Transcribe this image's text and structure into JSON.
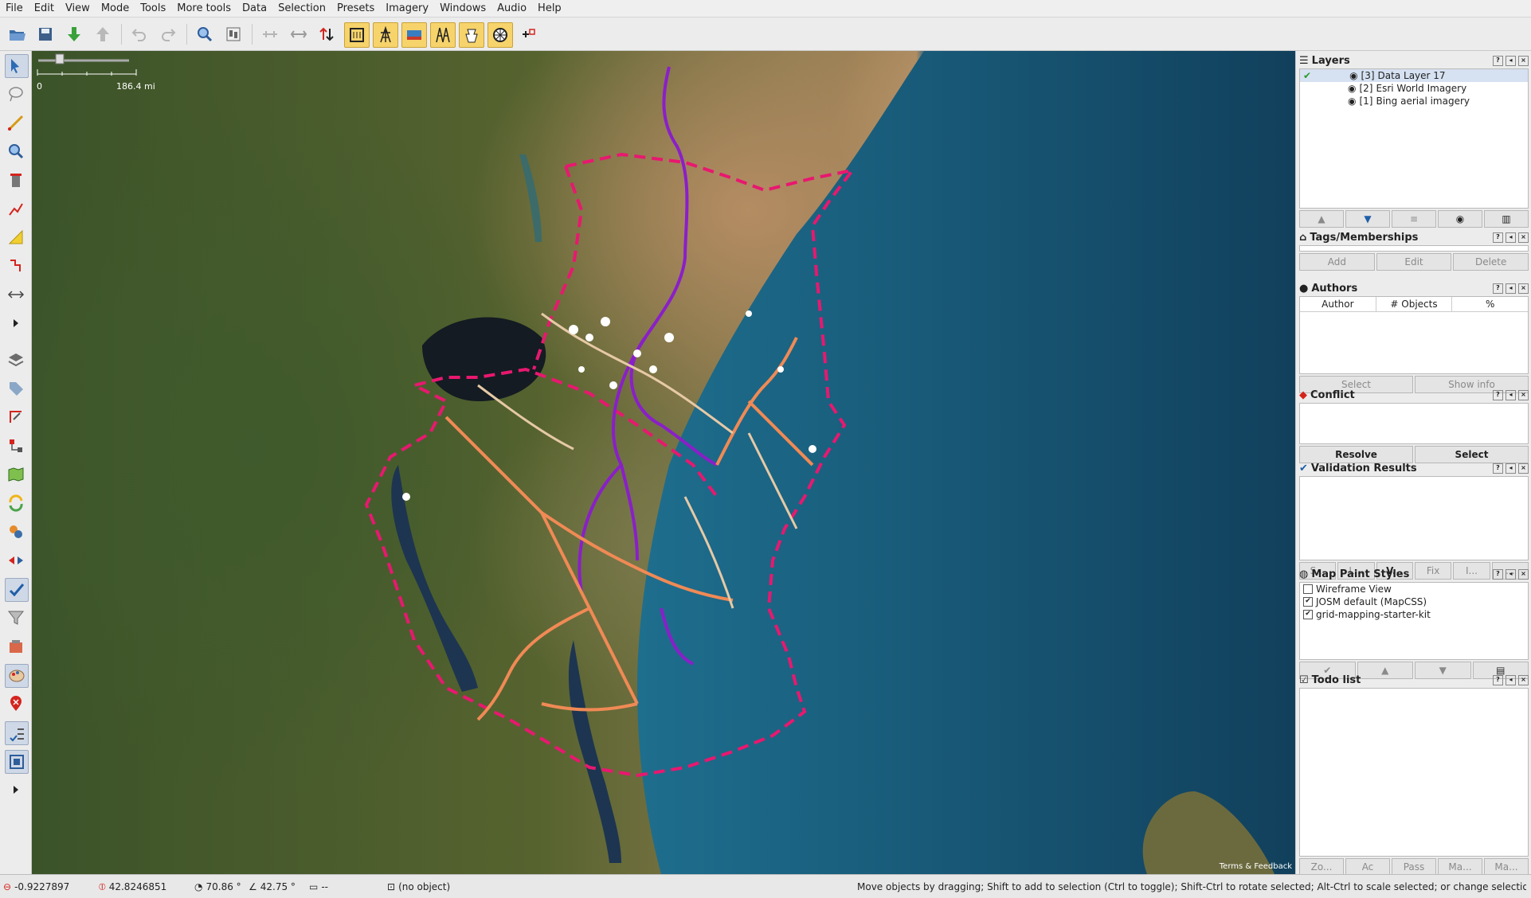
{
  "menu": [
    "File",
    "Edit",
    "View",
    "Mode",
    "Tools",
    "More tools",
    "Data",
    "Selection",
    "Presets",
    "Imagery",
    "Windows",
    "Audio",
    "Help"
  ],
  "toolbar": {
    "icons": [
      "open-icon",
      "save-icon",
      "download-icon",
      "upload-icon",
      "undo-icon",
      "redo-icon",
      "zoom-icon",
      "preferences-icon",
      "align-icon",
      "flip-icon",
      "split-icon",
      "tool-a-icon",
      "tool-b-icon",
      "tool-c-icon",
      "tool-d-icon",
      "tool-e-icon",
      "tool-f-icon",
      "add-tool-icon"
    ]
  },
  "scale": {
    "start": "0",
    "end": "186.4 mi"
  },
  "map": {
    "attribution": "Terms & Feedback"
  },
  "layers": {
    "title": "Layers",
    "items": [
      {
        "index": "[3]",
        "name": "Data Layer 17"
      },
      {
        "index": "[2]",
        "name": "Esri World Imagery"
      },
      {
        "index": "[1]",
        "name": "Bing aerial imagery"
      }
    ]
  },
  "tags": {
    "title": "Tags/Memberships",
    "add": "Add",
    "edit": "Edit",
    "delete": "Delete"
  },
  "authors": {
    "title": "Authors",
    "col_author": "Author",
    "col_objects": "# Objects",
    "col_pct": "%",
    "select": "Select",
    "show_info": "Show info"
  },
  "conflict": {
    "title": "Conflict",
    "resolve": "Resolve",
    "select": "Select"
  },
  "validation": {
    "title": "Validation Results",
    "buttons": [
      "S...",
      "L...",
      "V...",
      "Fix",
      "I...",
      "..."
    ]
  },
  "mappaint": {
    "title": "Map Paint Styles",
    "items": [
      {
        "name": "Wireframe View",
        "checked": false
      },
      {
        "name": "JOSM default (MapCSS)",
        "checked": true
      },
      {
        "name": "grid-mapping-starter-kit",
        "checked": true
      }
    ]
  },
  "todo": {
    "title": "Todo list",
    "buttons": [
      "Zo...",
      "Ac",
      "Pass",
      "Ma...",
      "Ma..."
    ]
  },
  "status": {
    "lat": "-0.9227897",
    "lon": "42.8246851",
    "heading": "70.86 °",
    "angle": "42.75 °",
    "distance": "--",
    "object": "(no object)",
    "help": "Move objects by dragging; Shift to add to selection (Ctrl to toggle); Shift-Ctrl to rotate selected; Alt-Ctrl to scale selected; or change selection"
  },
  "colors": {
    "border": "#e8186f",
    "highway": "#f08a55",
    "trunk": "#8a1fc9",
    "track": "#e6c9a6"
  }
}
